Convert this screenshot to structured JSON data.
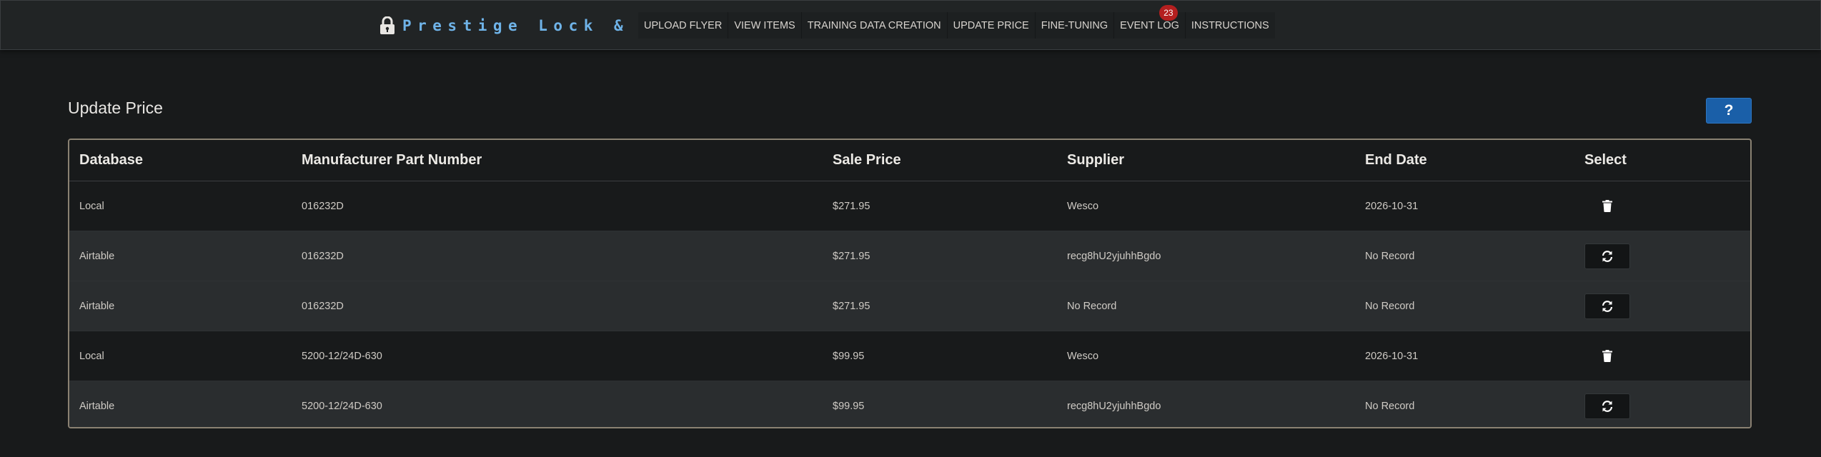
{
  "brand": {
    "name": "Prestige Lock & Door",
    "icon": "lock-icon"
  },
  "nav": {
    "items": [
      {
        "label": "UPLOAD FLYER"
      },
      {
        "label": "VIEW ITEMS"
      },
      {
        "label": "TRAINING DATA CREATION"
      },
      {
        "label": "UPDATE PRICE"
      },
      {
        "label": "FINE-TUNING"
      },
      {
        "label": "EVENT LOG",
        "badge": "23"
      },
      {
        "label": "INSTRUCTIONS"
      }
    ]
  },
  "page": {
    "title": "Update Price",
    "help_label": "?"
  },
  "table": {
    "headers": [
      "Database",
      "Manufacturer Part Number",
      "Sale Price",
      "Supplier",
      "End Date",
      "Select"
    ],
    "rows": [
      {
        "database": "Local",
        "part_number": "016232D",
        "sale_price": "$271.95",
        "supplier": "Wesco",
        "end_date": "2026-10-31",
        "action": "trash-icon"
      },
      {
        "database": "Airtable",
        "part_number": "016232D",
        "sale_price": "$271.95",
        "supplier": "recg8hU2yjuhhBgdo",
        "end_date": "No Record",
        "action": "sync-icon"
      },
      {
        "database": "Airtable",
        "part_number": "016232D",
        "sale_price": "$271.95",
        "supplier": "No Record",
        "end_date": "No Record",
        "action": "sync-icon"
      },
      {
        "database": "Local",
        "part_number": "5200-12/24D-630",
        "sale_price": "$99.95",
        "supplier": "Wesco",
        "end_date": "2026-10-31",
        "action": "trash-icon"
      },
      {
        "database": "Airtable",
        "part_number": "5200-12/24D-630",
        "sale_price": "$99.95",
        "supplier": "recg8hU2yjuhhBgdo",
        "end_date": "No Record",
        "action": "sync-icon"
      }
    ]
  },
  "colors": {
    "background": "#181a1b",
    "brand": "#6fb3e8",
    "badge": "#b41f1f",
    "help_button": "#1a5fa8",
    "table_border": "#8a8172"
  }
}
